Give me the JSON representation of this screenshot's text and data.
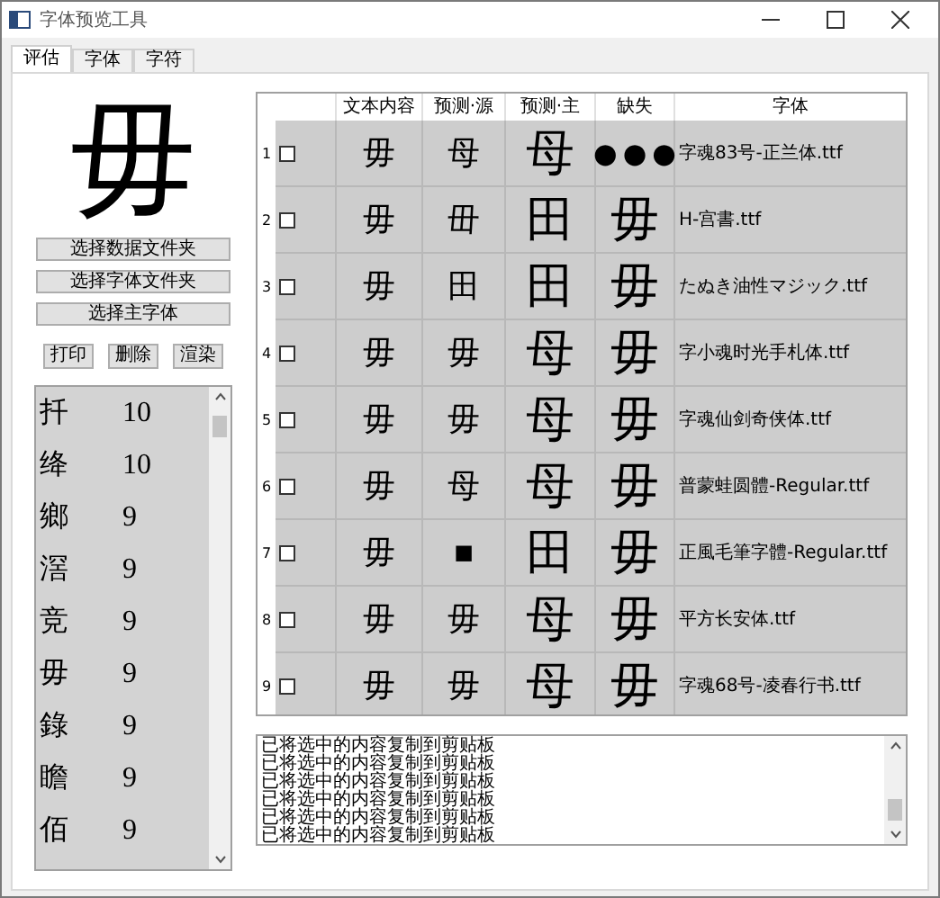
{
  "window": {
    "title": "字体预览工具"
  },
  "tabs": [
    {
      "label": "评估",
      "selected": true
    },
    {
      "label": "字体",
      "selected": false
    },
    {
      "label": "字符",
      "selected": false
    }
  ],
  "preview_char": "毋",
  "folder_buttons": [
    "选择数据文件夹",
    "选择字体文件夹",
    "选择主字体"
  ],
  "action_buttons": [
    "打印",
    "删除",
    "渲染"
  ],
  "char_list": [
    {
      "char": "扦",
      "count": "10"
    },
    {
      "char": "绛",
      "count": "10"
    },
    {
      "char": "鄉",
      "count": "9"
    },
    {
      "char": "滘",
      "count": "9"
    },
    {
      "char": "竞",
      "count": "9"
    },
    {
      "char": "毋",
      "count": "9"
    },
    {
      "char": "錄",
      "count": "9"
    },
    {
      "char": "瞻",
      "count": "9"
    },
    {
      "char": "佰",
      "count": "9"
    }
  ],
  "table": {
    "columns": [
      "文本内容",
      "预测·源",
      "预测·主",
      "缺失",
      "字体"
    ],
    "rows": [
      {
        "index": "1",
        "checked": false,
        "text": "毋",
        "source": "母",
        "main": "母",
        "missing": "●●●",
        "font": "字魂83号-正兰体.ttf"
      },
      {
        "index": "2",
        "checked": false,
        "text": "毋",
        "source": "毌",
        "main": "田",
        "missing": "毋",
        "font": "H-宫書.ttf"
      },
      {
        "index": "3",
        "checked": false,
        "text": "毋",
        "source": "田",
        "main": "田",
        "missing": "毋",
        "font": "たぬき油性マジック.ttf"
      },
      {
        "index": "4",
        "checked": false,
        "text": "毋",
        "source": "毋",
        "main": "母",
        "missing": "毋",
        "font": "字小魂时光手札体.ttf"
      },
      {
        "index": "5",
        "checked": false,
        "text": "毋",
        "source": "毋",
        "main": "母",
        "missing": "毋",
        "font": "字魂仙剑奇侠体.ttf"
      },
      {
        "index": "6",
        "checked": false,
        "text": "毋",
        "source": "母",
        "main": "母",
        "missing": "毋",
        "font": "普蒙蛙圆體-Regular.ttf"
      },
      {
        "index": "7",
        "checked": false,
        "text": "毋",
        "source": "■",
        "main": "田",
        "missing": "毋",
        "font": "正風毛筆字體-Regular.ttf"
      },
      {
        "index": "8",
        "checked": false,
        "text": "毋",
        "source": "毋",
        "main": "母",
        "missing": "毋",
        "font": "平方长安体.ttf"
      },
      {
        "index": "9",
        "checked": false,
        "text": "毋",
        "source": "毋",
        "main": "母",
        "missing": "毋",
        "font": "字魂68号-凌春行书.ttf"
      }
    ]
  },
  "log": [
    "已将选中的内容复制到剪贴板",
    "已将选中的内容复制到剪贴板",
    "已将选中的内容复制到剪贴板",
    "已将选中的内容复制到剪贴板",
    "已将选中的内容复制到剪贴板",
    "已将选中的内容复制到剪贴板"
  ]
}
